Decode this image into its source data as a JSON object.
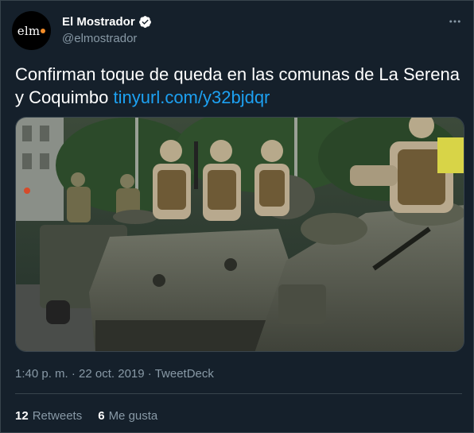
{
  "author": {
    "avatar_text": "elm",
    "display_name": "El Mostrador",
    "handle": "@elmostrador",
    "verified": true
  },
  "tweet": {
    "text": "Confirman toque de queda en las comunas de La Serena y Coquimbo",
    "link": "tinyurl.com/y32bjdqr",
    "media_description": "Photo"
  },
  "meta": {
    "time": "1:40 p. m.",
    "separator": "·",
    "date": "22 oct. 2019",
    "source": "TweetDeck"
  },
  "stats": {
    "retweets_count": "12",
    "retweets_label": "Retweets",
    "likes_count": "6",
    "likes_label": "Me gusta"
  },
  "icons": {
    "verified": "verified-badge-icon",
    "more": "more-options-icon"
  },
  "colors": {
    "background": "#15202b",
    "link": "#1da1f2",
    "secondary_text": "#8899a6",
    "border": "#38444d"
  }
}
